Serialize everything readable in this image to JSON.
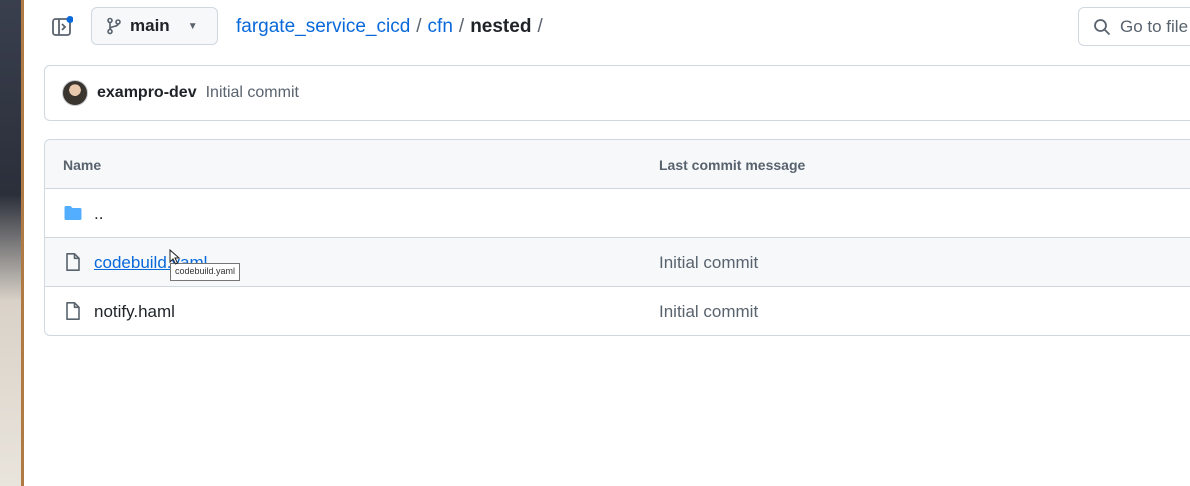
{
  "branch": {
    "name": "main"
  },
  "breadcrumb": {
    "repo": "fargate_service_cicd",
    "folder": "cfn",
    "current": "nested",
    "separator": "/"
  },
  "search": {
    "placeholder": "Go to file"
  },
  "latest_commit": {
    "author": "exampro-dev",
    "message": "Initial commit"
  },
  "table": {
    "headers": {
      "name": "Name",
      "message": "Last commit message"
    },
    "rows": [
      {
        "name": "..",
        "message": "",
        "icon": "folder-icon"
      },
      {
        "name": "codebuild.yaml",
        "message": "Initial commit",
        "icon": "file-icon"
      },
      {
        "name": "notify.haml",
        "message": "Initial commit",
        "icon": "file-icon"
      }
    ]
  },
  "tooltip": {
    "text": "codebuild.yaml"
  },
  "colors": {
    "link": "#0969da",
    "muted": "#59636e",
    "border": "#d0d7de",
    "header_bg": "#f6f8fa",
    "folder": "#54aeff"
  }
}
